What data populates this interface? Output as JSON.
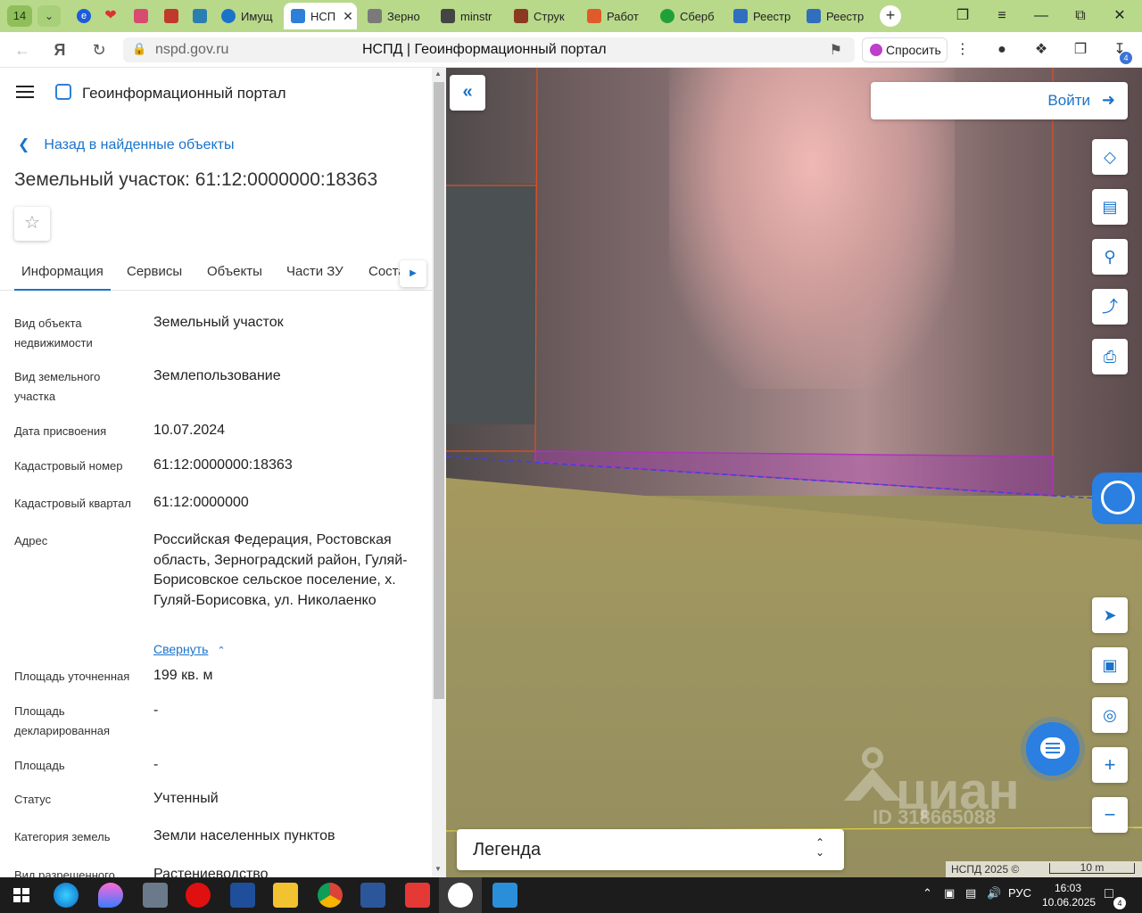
{
  "browser": {
    "tab_count": "14",
    "tabs": [
      {
        "label": "",
        "color": "#1e5bd8",
        "icon": "yandex-blue-icon"
      },
      {
        "label": "",
        "color": "#e03030",
        "icon": "heart-icon"
      },
      {
        "label": "",
        "color": "#d94a70",
        "icon": "app-icon"
      },
      {
        "label": "",
        "color": "#c0392b",
        "icon": "rocket-icon"
      },
      {
        "label": "",
        "color": "#2a7fb0",
        "icon": "feather-icon"
      },
      {
        "label": "Имущ",
        "color": "#1a73c9",
        "icon": "globe-icon"
      },
      {
        "label": "НСП",
        "color": "#2d7fd8",
        "icon": "nspd-icon"
      },
      {
        "label": "Зерно",
        "color": "#7a7a7a",
        "icon": "doc-icon"
      },
      {
        "label": "minstr",
        "color": "#444444",
        "icon": "file-icon"
      },
      {
        "label": "Струк",
        "color": "#8b3a1f",
        "icon": "emblem-icon"
      },
      {
        "label": "Работ",
        "color": "#e05a2a",
        "icon": "dots-icon"
      },
      {
        "label": "Сберб",
        "color": "#21a038",
        "icon": "sber-icon"
      },
      {
        "label": "Реестр",
        "color": "#2f6fbe",
        "icon": "eagle-icon"
      },
      {
        "label": "Реестр",
        "color": "#2f6fbe",
        "icon": "eagle-icon"
      }
    ],
    "url_host": "nspd.gov.ru",
    "page_title": "НСПД | Геоинформационный портал",
    "ask_label": "Спросить",
    "downloads_badge": "4"
  },
  "panel": {
    "portal_name": "Геоинформационный портал",
    "back_label": "Назад в найденные объекты",
    "title": "Земельный участок: 61:12:0000000:18363",
    "tabs": [
      "Информация",
      "Сервисы",
      "Объекты",
      "Части ЗУ",
      "Соста"
    ],
    "props": [
      {
        "label": "Вид объекта недвижимости",
        "value": "Земельный участок"
      },
      {
        "label": "Вид земельного участка",
        "value": "Землепользование"
      },
      {
        "label": "Дата присвоения",
        "value": "10.07.2024"
      },
      {
        "label": "Кадастровый номер",
        "value": "61:12:0000000:18363"
      },
      {
        "label": "Кадастровый квартал",
        "value": "61:12:0000000"
      },
      {
        "label": "Адрес",
        "value": "Российская Федерация, Ростовская область, Зерноградский район, Гуляй-Борисовское сельское поселение, х. Гуляй-Борисовка, ул. Николаенко"
      },
      {
        "label": "Площадь уточненная",
        "value": "199 кв. м"
      },
      {
        "label": "Площадь декларированная",
        "value": "-"
      },
      {
        "label": "Площадь",
        "value": "-"
      },
      {
        "label": "Статус",
        "value": "Учтенный"
      },
      {
        "label": "Категория земель",
        "value": "Земли населенных пунктов"
      },
      {
        "label": "Вид разрешенного",
        "value": "Растениеводство"
      }
    ],
    "collapse_label": "Свернуть"
  },
  "map": {
    "login_label": "Войти",
    "legend_label": "Легенда",
    "attribution": "НСПД 2025 ©",
    "scale_label": "10 m",
    "watermark_brand": "циан",
    "watermark_id": "ID 318665088",
    "parcel_color": "#b030c0",
    "boundary_color": "#e05020"
  },
  "taskbar": {
    "lang": "РУС",
    "time": "16:03",
    "date": "10.06.2025",
    "notifications": "4"
  }
}
